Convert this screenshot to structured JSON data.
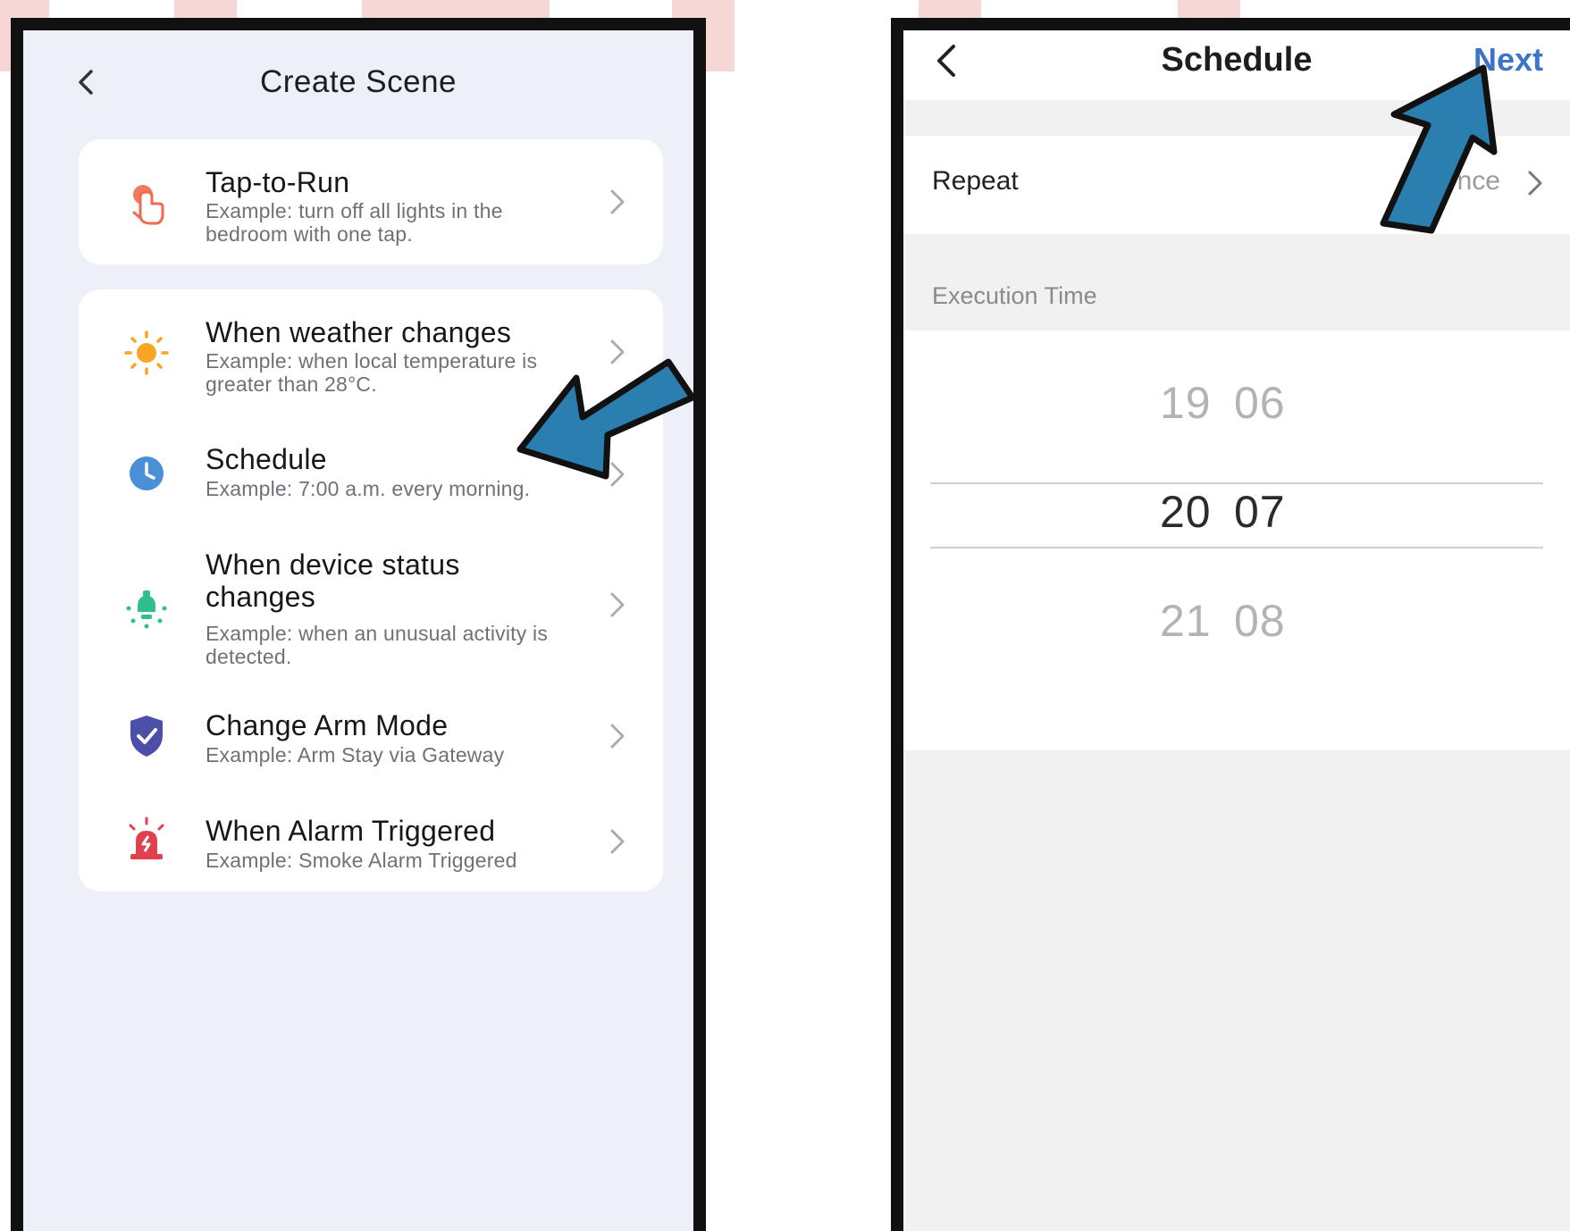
{
  "left": {
    "title": "Create Scene",
    "cards": [
      {
        "rows": [
          {
            "title": "Tap-to-Run",
            "desc": "Example: turn off all lights in the bedroom with one tap.",
            "icon": "tap-icon",
            "color": "#ef6a4f"
          }
        ]
      },
      {
        "rows": [
          {
            "title": "When weather changes",
            "desc": "Example: when local temperature is greater than 28°C.",
            "icon": "sun-icon",
            "color": "#f6a623"
          },
          {
            "title": "Schedule",
            "desc": "Example: 7:00 a.m. every morning.",
            "icon": "clock-icon",
            "color": "#4a90d9"
          },
          {
            "title": "When device status changes",
            "desc": "Example: when an unusual activity is detected.",
            "icon": "device-bulb-icon",
            "color": "#2fbf8a"
          },
          {
            "title": "Change Arm Mode",
            "desc": "Example: Arm Stay via Gateway",
            "icon": "shield-check-icon",
            "color": "#4b4fa8"
          },
          {
            "title": "When Alarm Triggered",
            "desc": "Example: Smoke Alarm Triggered",
            "icon": "alarm-siren-icon",
            "color": "#e0414d"
          }
        ]
      }
    ]
  },
  "right": {
    "title": "Schedule",
    "next_label": "Next",
    "repeat": {
      "label": "Repeat",
      "value": "Once"
    },
    "execution_time_label": "Execution Time",
    "picker": {
      "above": {
        "hour": "19",
        "minute": "06"
      },
      "selected": {
        "hour": "20",
        "minute": "07"
      },
      "below": {
        "hour": "21",
        "minute": "08"
      }
    }
  },
  "accent_colors": {
    "arrow": "#2a7fb0",
    "next": "#3d73c9",
    "watermark": "#f6cfcf"
  }
}
